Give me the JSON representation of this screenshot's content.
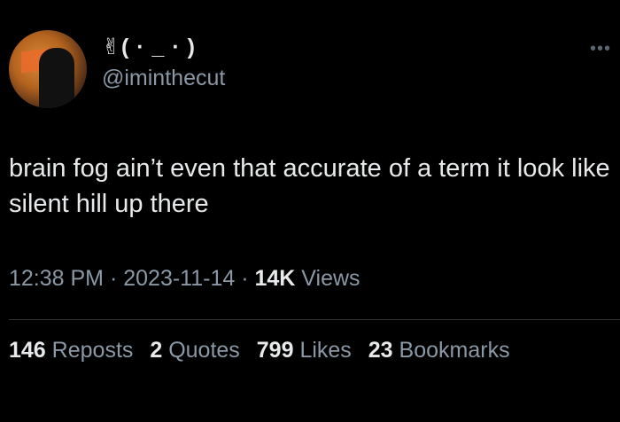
{
  "user": {
    "display_name": "✌( · _ · )",
    "handle": "@iminthecut"
  },
  "more_icon": "ellipsis-icon",
  "tweet": {
    "text": "brain fog ain’t even that accurate of a term it look like silent hill up there"
  },
  "meta": {
    "time": "12:38 PM",
    "sep1": " · ",
    "date": "2023-11-14",
    "sep2": " · ",
    "views_count": "14K",
    "views_label": " Views"
  },
  "stats": [
    {
      "count": "146",
      "label": "Reposts"
    },
    {
      "count": "2",
      "label": "Quotes"
    },
    {
      "count": "799",
      "label": "Likes"
    },
    {
      "count": "23",
      "label": "Bookmarks"
    }
  ],
  "colors": {
    "background": "#000000",
    "primary_text": "#e7e9ea",
    "secondary_text": "#8b98a5",
    "divider": "#2f3336"
  }
}
